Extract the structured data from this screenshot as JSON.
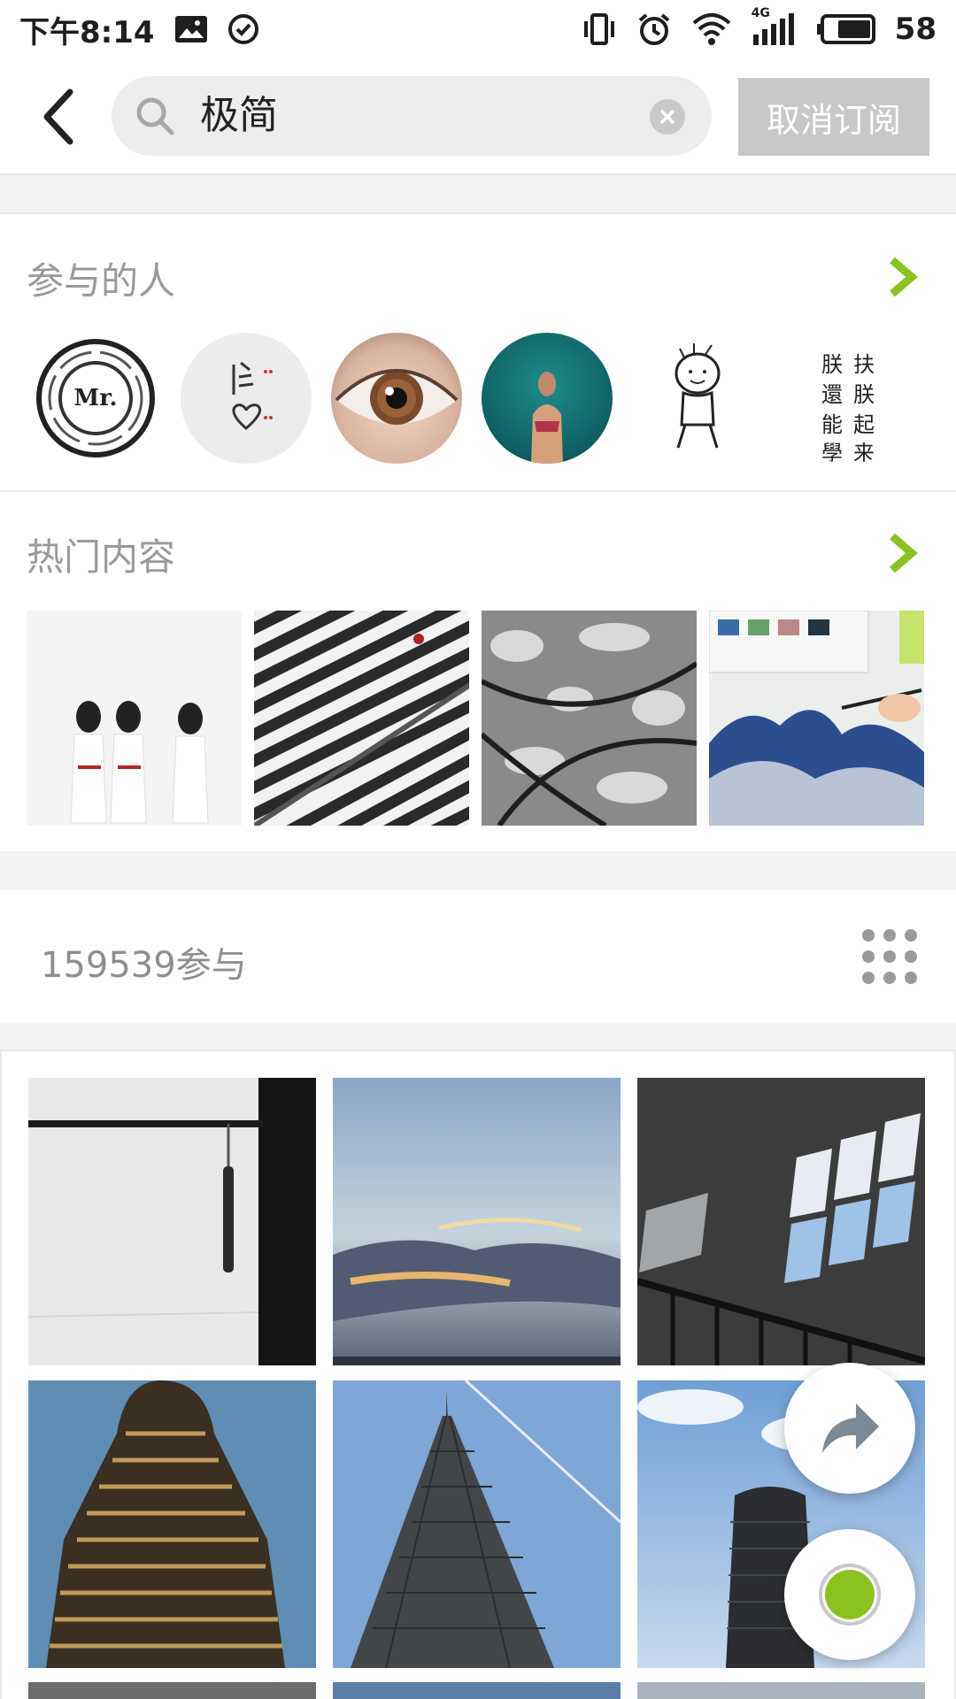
{
  "status_bar": {
    "time": "下午8:14",
    "battery": "58",
    "network": "4G"
  },
  "header": {
    "search_value": "极简",
    "unsubscribe_label": "取消订阅"
  },
  "participants": {
    "title": "参与的人",
    "avatars": [
      {
        "icon": "mr-logo",
        "text": "Mr."
      },
      {
        "icon": "calligraphy-heart"
      },
      {
        "icon": "eye-photo"
      },
      {
        "icon": "swimmer-photo"
      },
      {
        "icon": "doodle-figure"
      },
      {
        "icon": "calligraphy-text",
        "text": "朕 扶 還 朕 能 起 學 来"
      }
    ]
  },
  "hot_content": {
    "title": "热门内容"
  },
  "participation": {
    "count_label": "159539参与"
  },
  "colors": {
    "accent_green": "#8cc21f",
    "gap_gray": "#f1f3f3",
    "button_gray": "#c8c8c8"
  }
}
